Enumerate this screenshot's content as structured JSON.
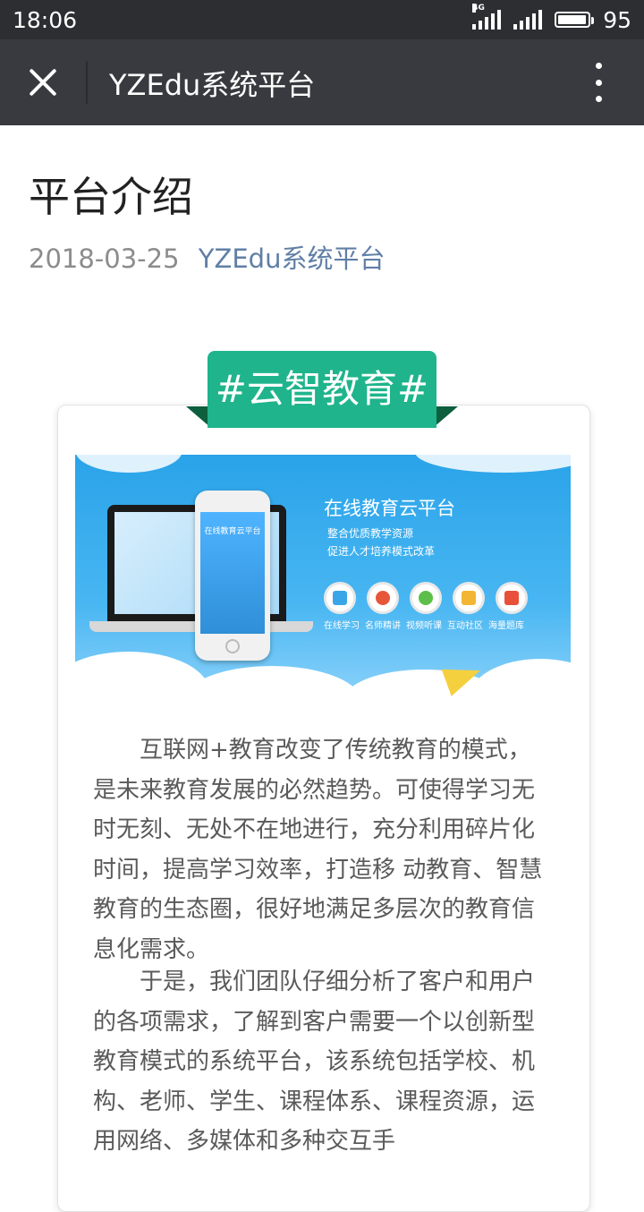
{
  "status_bar": {
    "time": "18:06",
    "network": "4G",
    "battery": "95"
  },
  "nav": {
    "title": "YZEdu系统平台"
  },
  "article": {
    "title": "平台介绍",
    "date": "2018-03-25",
    "account": "YZEdu系统平台",
    "banner_tag": "#云智教育#",
    "banner_image": {
      "title": "在线教育云平台",
      "subtitle_1": "整合优质教学资源",
      "subtitle_2": "促进人才培养模式改革",
      "phone_title": "在线教育云平台",
      "features": [
        "在线学习",
        "名师精讲",
        "视频听课",
        "互动社区",
        "海量题库"
      ]
    },
    "paragraphs": [
      "互联网+教育改变了传统教育的模式，是未来教育发展的必然趋势。可使得学习无时无刻、无处不在地进行，充分利用碎片化时间，提高学习效率，打造移 动教育、智慧教育的生态圈，很好地满足多层次的教育信息化需求。",
      "于是，我们团队仔细分析了客户和用户的各项需求，了解到客户需要一个以创新型教育模式的系统平台，该系统包括学校、机构、老师、学生、课程体系、课程资源，运用网络、多媒体和多种交互手"
    ]
  },
  "colors": {
    "status_bar_bg": "#2d2e31",
    "nav_bg": "#393a3f",
    "ribbon": "#1fb48c",
    "account_link": "#607fa6"
  }
}
